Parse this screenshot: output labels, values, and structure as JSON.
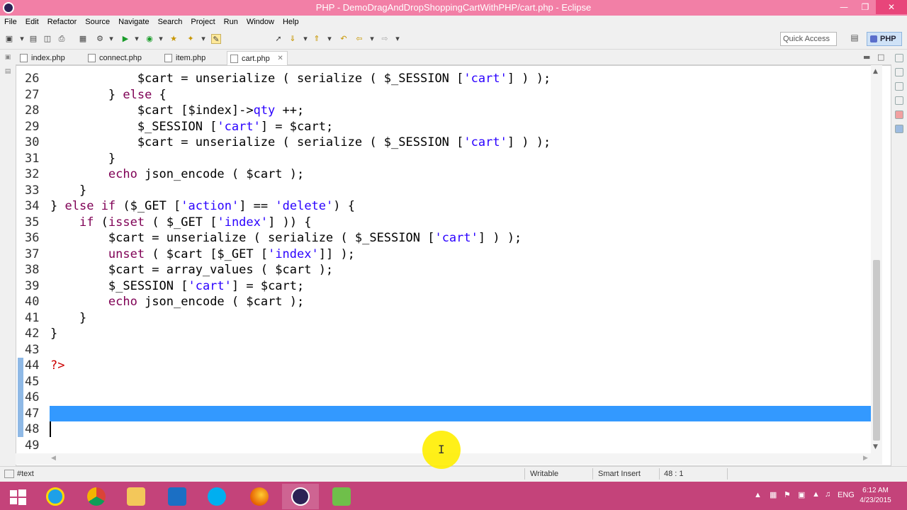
{
  "window": {
    "title": "PHP - DemoDragAndDropShoppingCartWithPHP/cart.php - Eclipse"
  },
  "menu": [
    "File",
    "Edit",
    "Refactor",
    "Source",
    "Navigate",
    "Search",
    "Project",
    "Run",
    "Window",
    "Help"
  ],
  "toolbar": {
    "quick_access": "Quick Access",
    "perspective": "PHP"
  },
  "tabs": [
    {
      "label": "index.php",
      "active": false
    },
    {
      "label": "connect.php",
      "active": false
    },
    {
      "label": "item.php",
      "active": false
    },
    {
      "label": "cart.php",
      "active": true
    }
  ],
  "editor": {
    "lines": [
      {
        "n": "26",
        "code": "            $cart = unserialize ( serialize ( $_SESSION ['cart'] ) );"
      },
      {
        "n": "27",
        "code": "        } else {"
      },
      {
        "n": "28",
        "code": "            $cart [$index]->qty ++;"
      },
      {
        "n": "29",
        "code": "            $_SESSION ['cart'] = $cart;"
      },
      {
        "n": "30",
        "code": "            $cart = unserialize ( serialize ( $_SESSION ['cart'] ) );"
      },
      {
        "n": "31",
        "code": "        }"
      },
      {
        "n": "32",
        "code": "        echo json_encode ( $cart );"
      },
      {
        "n": "33",
        "code": "    }"
      },
      {
        "n": "34",
        "code": "} else if ($_GET ['action'] == 'delete') {"
      },
      {
        "n": "35",
        "code": "    if (isset ( $_GET ['index'] )) {"
      },
      {
        "n": "36",
        "code": "        $cart = unserialize ( serialize ( $_SESSION ['cart'] ) );"
      },
      {
        "n": "37",
        "code": "        unset ( $cart [$_GET ['index']] );"
      },
      {
        "n": "38",
        "code": "        $cart = array_values ( $cart );"
      },
      {
        "n": "39",
        "code": "        $_SESSION ['cart'] = $cart;"
      },
      {
        "n": "40",
        "code": "        echo json_encode ( $cart );"
      },
      {
        "n": "41",
        "code": "    }"
      },
      {
        "n": "42",
        "code": "}"
      },
      {
        "n": "43",
        "code": ""
      },
      {
        "n": "44",
        "code": "?>"
      },
      {
        "n": "45",
        "code": ""
      },
      {
        "n": "46",
        "code": ""
      },
      {
        "n": "47",
        "code": ""
      },
      {
        "n": "48",
        "code": ""
      },
      {
        "n": "49",
        "code": ""
      }
    ],
    "selected_line": "47",
    "caret_line": "48"
  },
  "status": {
    "context": "#text",
    "mode": "Writable",
    "insert": "Smart Insert",
    "position": "48 : 1"
  },
  "taskbar": {
    "apps": [
      "start-icon",
      "ie-icon",
      "chrome-icon",
      "file-explorer-icon",
      "outlook-icon",
      "skype-icon",
      "firefox-icon",
      "eclipse-icon",
      "notepad-icon"
    ],
    "language": "ENG",
    "time": "6:12 AM",
    "date": "4/23/2015"
  },
  "colors": {
    "titlebar": "#f27fa6",
    "taskbar": "#c4437a",
    "selection": "#3399ff",
    "keyword": "#7f0055",
    "string": "#2a00ff"
  }
}
